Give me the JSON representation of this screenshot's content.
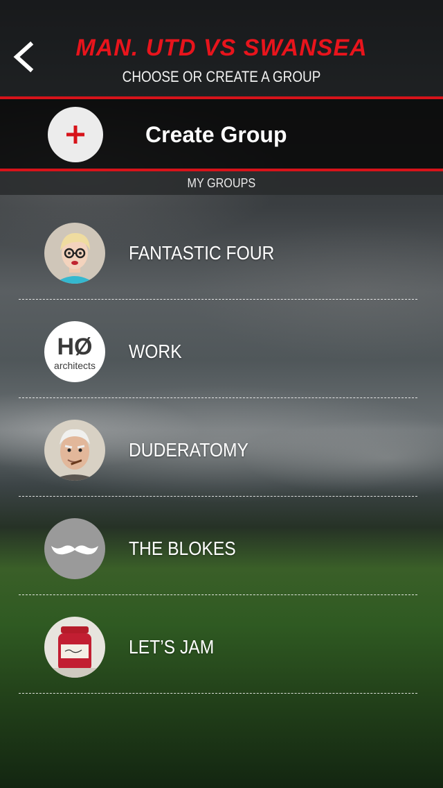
{
  "header": {
    "title": "MAN. UTD VS SWANSEA",
    "subtitle": "CHOOSE OR CREATE A GROUP",
    "back_icon": "chevron-left-icon"
  },
  "create_group": {
    "label": "Create Group",
    "icon": "plus-icon",
    "accent_color": "#d7131a"
  },
  "section": {
    "label": "MY GROUPS"
  },
  "groups": [
    {
      "name": "FANTASTIC FOUR",
      "avatar": "woman-with-glasses-avatar"
    },
    {
      "name": "WORK",
      "avatar": "ho-architects-logo"
    },
    {
      "name": "DUDERATOMY",
      "avatar": "old-man-avatar"
    },
    {
      "name": "THE BLOKES",
      "avatar": "mustache-icon"
    },
    {
      "name": "LET’S JAM",
      "avatar": "jam-jar-avatar"
    }
  ],
  "avatar_logo_text": {
    "ho": "HØ",
    "architects": "architects"
  }
}
